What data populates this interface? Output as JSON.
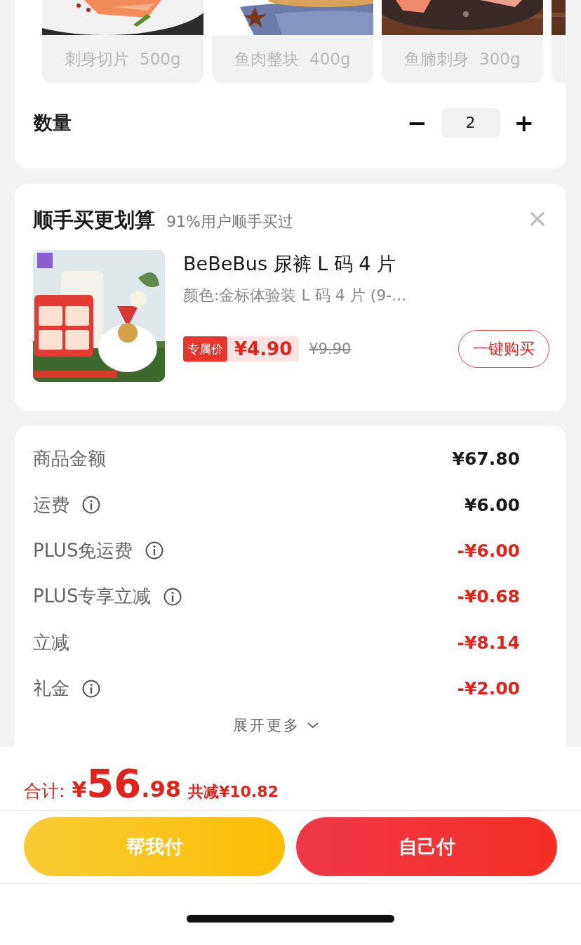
{
  "specs": [
    {
      "label": "刺身切片  500g"
    },
    {
      "label": "鱼肉整块  400g"
    },
    {
      "label": "鱼腩刺身  300g"
    }
  ],
  "quantity": {
    "label": "数量",
    "minus": "−",
    "value": "2",
    "plus": "+"
  },
  "addon": {
    "title": "顺手买更划算",
    "subtitle": "91%用户顺手买过",
    "close": "×",
    "product": {
      "kind": "picture",
      "name": "BeBeBus 尿裤 L 码 4 片",
      "variant": "颜色:金标体验装 L 码 4 片 (9-...",
      "price_tag": "专属价",
      "price": "¥4.90",
      "original_price": "¥9.90",
      "buy": "一键购买"
    }
  },
  "fees": [
    {
      "label": "商品金额",
      "info": false,
      "value": "¥67.80",
      "kind": "charge"
    },
    {
      "label": "运费",
      "info": true,
      "value": "¥6.00",
      "kind": "charge"
    },
    {
      "label": "PLUS免运费",
      "info": true,
      "value": "-¥6.00",
      "kind": "discount"
    },
    {
      "label": "PLUS专享立减",
      "info": true,
      "value": "-¥0.68",
      "kind": "discount"
    },
    {
      "label": "立减",
      "info": false,
      "value": "-¥8.14",
      "kind": "discount"
    },
    {
      "label": "礼金",
      "info": true,
      "value": "-¥2.00",
      "kind": "discount"
    }
  ],
  "expand": "展开更多",
  "total": {
    "label": "合计:",
    "currency": "¥",
    "integer": "56",
    "decimal": ".98",
    "saved": "共减¥10.82"
  },
  "buttons": [
    {
      "label": "帮我付",
      "kind": "friend"
    },
    {
      "label": "自己付",
      "kind": "self"
    }
  ]
}
